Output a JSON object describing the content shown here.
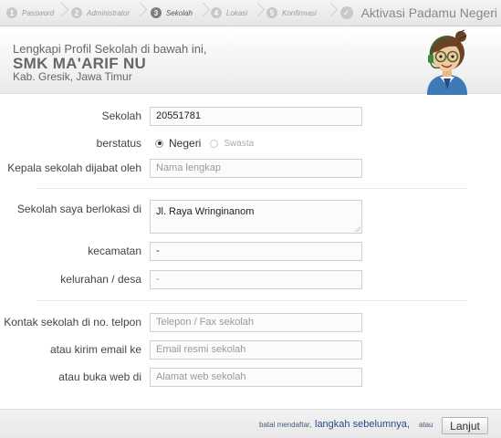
{
  "steps": [
    {
      "num": "1",
      "label": "Password"
    },
    {
      "num": "2",
      "label": "Administrator"
    },
    {
      "num": "3",
      "label": "Sekolah"
    },
    {
      "num": "4",
      "label": "Lokasi"
    },
    {
      "num": "5",
      "label": "Konfirmasi"
    }
  ],
  "active_step": 3,
  "final_step": {
    "check": "✓",
    "title": "Aktivasi Padamu Negeri"
  },
  "header": {
    "intro": "Lengkapi Profil Sekolah di bawah ini,",
    "school_name": "SMK MA'ARIF NU",
    "location": "Kab. Gresik, Jawa Timur"
  },
  "form": {
    "sekolah": {
      "label": "Sekolah",
      "value": "20551781"
    },
    "status": {
      "label": "berstatus",
      "option_selected": "Negeri",
      "option_other": "Swasta"
    },
    "kepala": {
      "label": "Kepala sekolah dijabat oleh",
      "placeholder": "Nama lengkap"
    },
    "lokasi": {
      "label": "Sekolah saya berlokasi di",
      "value": "Jl. Raya Wringinanom"
    },
    "kecamatan": {
      "label": "kecamatan",
      "value": "-"
    },
    "kelurahan": {
      "label": "kelurahan / desa",
      "value": "-"
    },
    "telpon": {
      "label": "Kontak sekolah di no. telpon",
      "placeholder": "Telepon / Fax sekolah"
    },
    "email": {
      "label": "atau kirim email ke",
      "placeholder": "Email resmi sekolah"
    },
    "web": {
      "label": "atau buka web di",
      "placeholder": "Alamat web sekolah"
    }
  },
  "footer": {
    "cancel": "batal mendaftar,",
    "back": "langkah sebelumnya,",
    "or": "atau",
    "next": "Lanjut"
  }
}
